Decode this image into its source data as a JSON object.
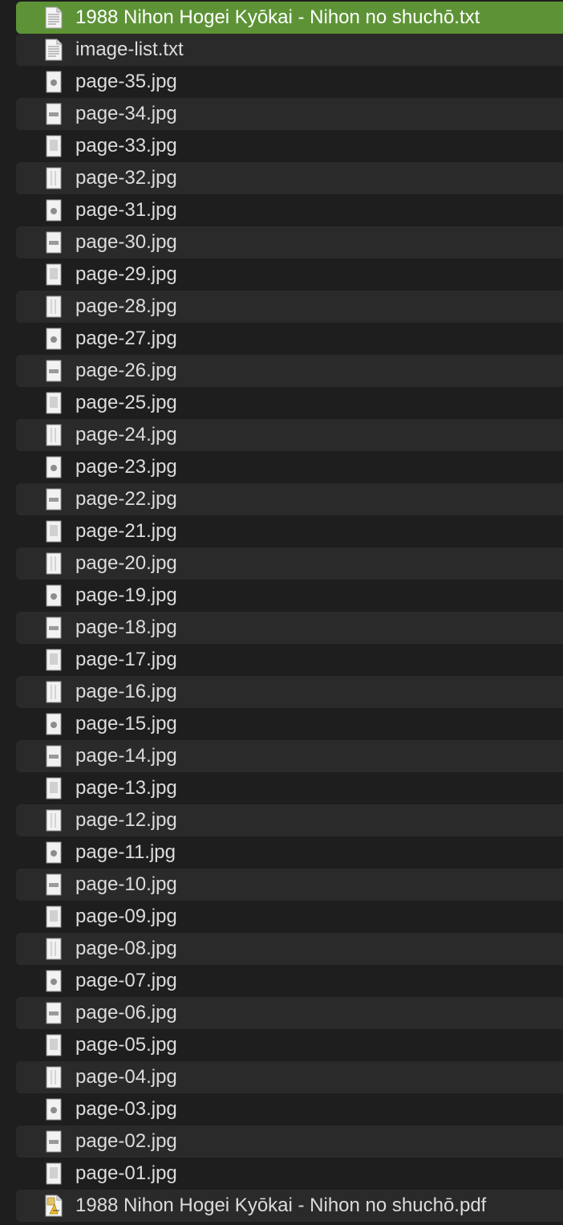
{
  "colors": {
    "background": "#1e1e1e",
    "row_alt": "#2a2a2a",
    "selected": "#5d9336",
    "text": "#dcdcdc"
  },
  "files": [
    {
      "name": "1988 Nihon Hogei Kyōkai - Nihon no shuchō.txt",
      "icon": "text-document-icon",
      "selected": true
    },
    {
      "name": "image-list.txt",
      "icon": "text-document-icon"
    },
    {
      "name": "page-35.jpg",
      "icon": "image-thumbnail-icon"
    },
    {
      "name": "page-34.jpg",
      "icon": "image-thumbnail-icon"
    },
    {
      "name": "page-33.jpg",
      "icon": "image-thumbnail-icon"
    },
    {
      "name": "page-32.jpg",
      "icon": "image-thumbnail-icon"
    },
    {
      "name": "page-31.jpg",
      "icon": "image-thumbnail-icon"
    },
    {
      "name": "page-30.jpg",
      "icon": "image-thumbnail-icon"
    },
    {
      "name": "page-29.jpg",
      "icon": "image-thumbnail-icon"
    },
    {
      "name": "page-28.jpg",
      "icon": "image-thumbnail-icon"
    },
    {
      "name": "page-27.jpg",
      "icon": "image-thumbnail-icon"
    },
    {
      "name": "page-26.jpg",
      "icon": "image-thumbnail-icon"
    },
    {
      "name": "page-25.jpg",
      "icon": "image-thumbnail-icon"
    },
    {
      "name": "page-24.jpg",
      "icon": "image-thumbnail-icon"
    },
    {
      "name": "page-23.jpg",
      "icon": "image-thumbnail-icon"
    },
    {
      "name": "page-22.jpg",
      "icon": "image-thumbnail-icon"
    },
    {
      "name": "page-21.jpg",
      "icon": "image-thumbnail-icon"
    },
    {
      "name": "page-20.jpg",
      "icon": "image-thumbnail-icon"
    },
    {
      "name": "page-19.jpg",
      "icon": "image-thumbnail-icon"
    },
    {
      "name": "page-18.jpg",
      "icon": "image-thumbnail-icon"
    },
    {
      "name": "page-17.jpg",
      "icon": "image-thumbnail-icon"
    },
    {
      "name": "page-16.jpg",
      "icon": "image-thumbnail-icon"
    },
    {
      "name": "page-15.jpg",
      "icon": "image-thumbnail-icon"
    },
    {
      "name": "page-14.jpg",
      "icon": "image-thumbnail-icon"
    },
    {
      "name": "page-13.jpg",
      "icon": "image-thumbnail-icon"
    },
    {
      "name": "page-12.jpg",
      "icon": "image-thumbnail-icon"
    },
    {
      "name": "page-11.jpg",
      "icon": "image-thumbnail-icon"
    },
    {
      "name": "page-10.jpg",
      "icon": "image-thumbnail-icon"
    },
    {
      "name": "page-09.jpg",
      "icon": "image-thumbnail-icon"
    },
    {
      "name": "page-08.jpg",
      "icon": "image-thumbnail-icon"
    },
    {
      "name": "page-07.jpg",
      "icon": "image-thumbnail-icon"
    },
    {
      "name": "page-06.jpg",
      "icon": "image-thumbnail-icon"
    },
    {
      "name": "page-05.jpg",
      "icon": "image-thumbnail-icon"
    },
    {
      "name": "page-04.jpg",
      "icon": "image-thumbnail-icon"
    },
    {
      "name": "page-03.jpg",
      "icon": "image-thumbnail-icon"
    },
    {
      "name": "page-02.jpg",
      "icon": "image-thumbnail-icon"
    },
    {
      "name": "page-01.jpg",
      "icon": "image-thumbnail-icon"
    },
    {
      "name": "1988 Nihon Hogei Kyōkai - Nihon no shuchō.pdf",
      "icon": "pdf-document-icon"
    }
  ]
}
